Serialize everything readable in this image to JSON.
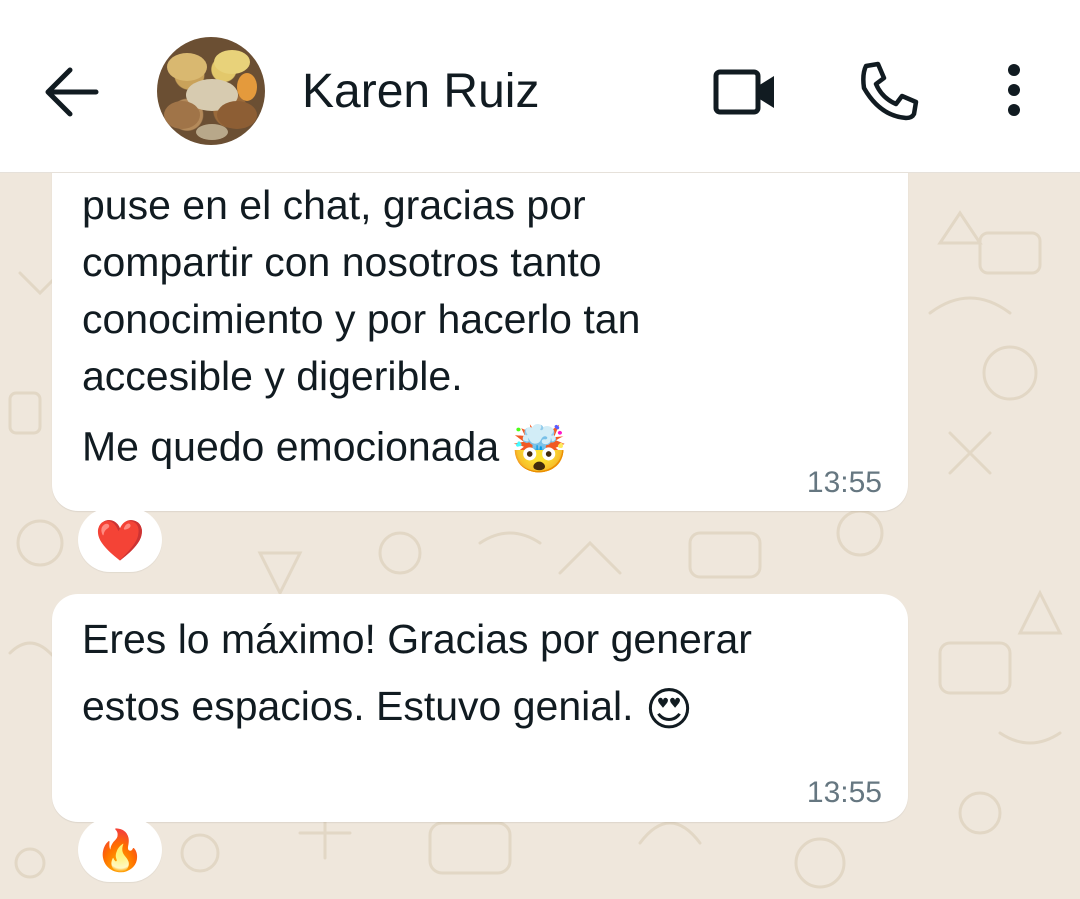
{
  "header": {
    "contact_name": "Karen Ruiz",
    "back_icon": "arrow-left-icon",
    "video_icon": "video-camera-icon",
    "phone_icon": "phone-icon",
    "menu_icon": "more-vertical-icon"
  },
  "messages": [
    {
      "lines": [
        "puse en el chat, gracias por",
        "compartir con nosotros tanto",
        "conocimiento y por hacerlo tan",
        "accesible y digerible.",
        "Me quedo emocionada"
      ],
      "emoji": "🤯",
      "time": "13:55",
      "reaction": "❤️"
    },
    {
      "lines": [
        "Eres lo máximo! Gracias por generar",
        "estos espacios. Estuvo genial."
      ],
      "emoji": "😍",
      "time": "13:55",
      "reaction": "🔥"
    }
  ],
  "colors": {
    "header_bg": "#ffffff",
    "chat_bg": "#efe7dc",
    "bubble_bg": "#ffffff",
    "timestamp": "#667781"
  }
}
